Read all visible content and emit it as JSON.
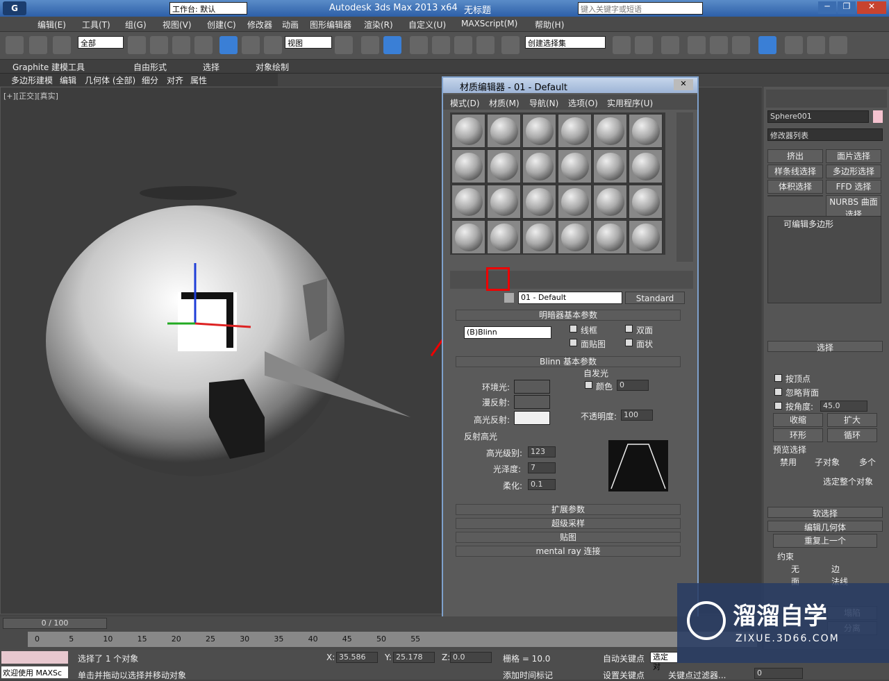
{
  "titlebar": {
    "workspace": "工作台: 默认",
    "app_title": "Autodesk 3ds Max  2013 x64",
    "doc": "无标题",
    "search_placeholder": "键入关键字或短语"
  },
  "menu": [
    "编辑(E)",
    "工具(T)",
    "组(G)",
    "视图(V)",
    "创建(C)",
    "修改器",
    "动画",
    "图形编辑器",
    "渲染(R)",
    "自定义(U)",
    "MAXScript(M)",
    "帮助(H)"
  ],
  "toolbar": {
    "selection_filter": "全部",
    "coord_system": "视图",
    "named_set": "创建选择集"
  },
  "ribbon": {
    "tabs": [
      "Graphite 建模工具",
      "自由形式",
      "选择",
      "对象绘制"
    ],
    "subtabs": [
      "多边形建模",
      "编辑",
      "几何体 (全部)",
      "细分",
      "对齐",
      "属性"
    ]
  },
  "viewport": {
    "label": "[+][正交][真实]"
  },
  "mat_editor": {
    "title": "材质编辑器 - 01 - Default",
    "menu": [
      "模式(D)",
      "材质(M)",
      "导航(N)",
      "选项(O)",
      "实用程序(U)"
    ],
    "material_name": "01 - Default",
    "material_type": "Standard",
    "shader_rollout": "明暗器基本参数",
    "shader": "(B)Blinn",
    "wire": "线框",
    "two_sided": "双面",
    "face_map": "面贴图",
    "faceted": "面状",
    "blinn_rollout": "Blinn 基本参数",
    "self_illum": "自发光",
    "color_label": "颜色",
    "color_val": "0",
    "ambient": "环境光:",
    "diffuse": "漫反射:",
    "specular": "高光反射:",
    "opacity_label": "不透明度:",
    "opacity": "100",
    "spec_hl": "反射高光",
    "spec_level_label": "高光级别:",
    "spec_level": "123",
    "gloss_label": "光泽度:",
    "gloss": "7",
    "soften_label": "柔化:",
    "soften": "0.1",
    "rollouts": [
      "扩展参数",
      "超级采样",
      "贴图",
      "mental ray 连接"
    ]
  },
  "cmd": {
    "object_name": "Sphere001",
    "modifier_list": "修改器列表",
    "buttons": [
      "挤出",
      "面片选择",
      "样条线选择",
      "多边形选择",
      "体积选择",
      "FFD 选择",
      "",
      "NURBS 曲面选择"
    ],
    "stack_item": "可编辑多边形",
    "sel_title": "选择",
    "by_vertex": "按顶点",
    "ignore_back": "忽略背面",
    "by_angle": "按角度:",
    "angle_val": "45.0",
    "shrink": "收缩",
    "grow": "扩大",
    "ring": "环形",
    "loop": "循环",
    "preview": "预览选择",
    "disable": "禁用",
    "subobj": "子对象",
    "multi": "多个",
    "select_whole": "选定整个对象",
    "soft_sel": "软选择",
    "edit_geo": "编辑几何体",
    "repeat_last": "重复上一个",
    "constraint": "约束",
    "none": "无",
    "edge": "边",
    "face": "面",
    "normal": "法线",
    "collapse": "塌陷",
    "detach": "分离"
  },
  "timeline": {
    "frame": "0 / 100",
    "ticks": [
      "0",
      "5",
      "10",
      "15",
      "20",
      "25",
      "30",
      "35",
      "40",
      "45",
      "50",
      "55"
    ]
  },
  "status": {
    "welcome": "欢迎使用 MAXSc",
    "selected": "选择了 1 个对象",
    "hint": "单击并拖动以选择并移动对象",
    "x_label": "X:",
    "x": "35.586",
    "y_label": "Y:",
    "y": "25.178",
    "z_label": "Z:",
    "z": "0.0",
    "grid": "栅格 = 10.0",
    "auto_key": "自动关键点",
    "set_key": "设置关键点",
    "sel_obj": "选定对",
    "add_time_tag": "添加时间标记",
    "key_filter": "关键点过滤器...",
    "frame_val": "0"
  },
  "watermark": {
    "brand": "溜溜自学",
    "url": "ZIXUE.3D66.COM"
  }
}
